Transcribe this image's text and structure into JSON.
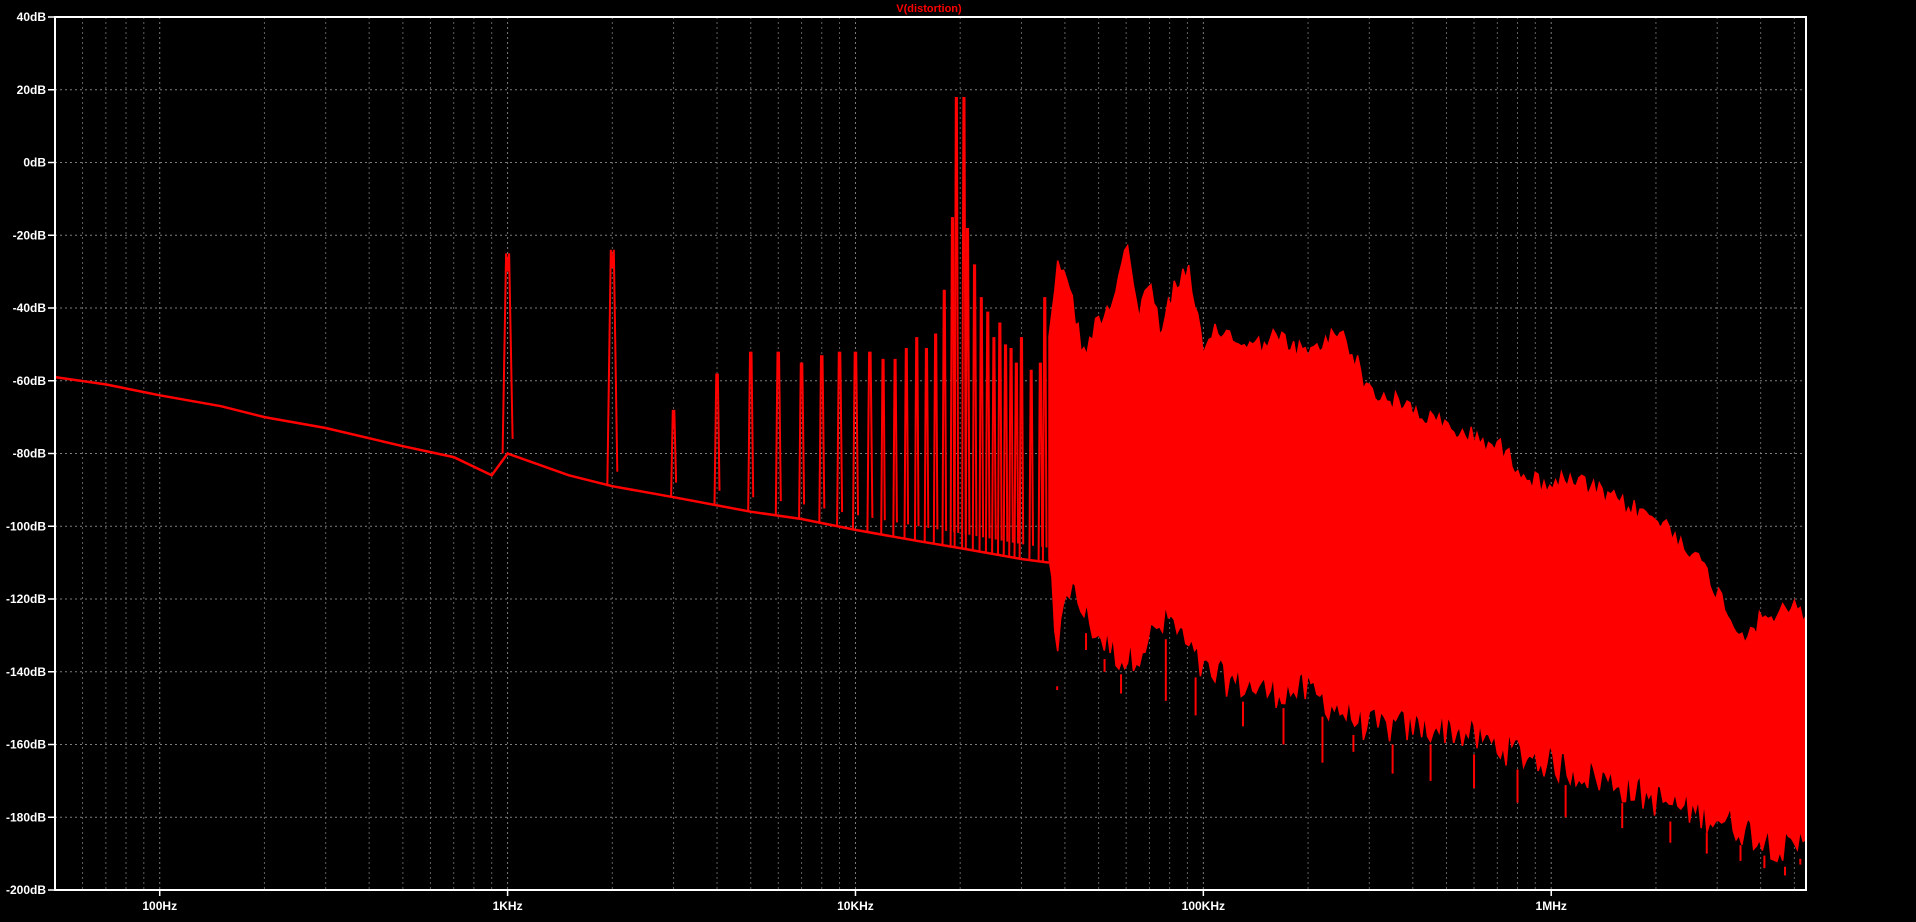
{
  "window": {
    "trace_label": "V(distortion)"
  },
  "colors": {
    "background": "#000000",
    "frame": "#ffffff",
    "grid": "#8a8a8a",
    "text": "#ffffff",
    "trace": "#ff0000"
  },
  "chart_data": {
    "type": "line",
    "title": "V(distortion)",
    "xlabel": "",
    "ylabel": "",
    "x_scale": "log",
    "xlim": [
      50,
      5400000
    ],
    "ylim": [
      -200,
      40
    ],
    "grid": true,
    "x_ticks": [
      {
        "value": 100,
        "label": "100Hz"
      },
      {
        "value": 1000,
        "label": "1KHz"
      },
      {
        "value": 10000,
        "label": "10KHz"
      },
      {
        "value": 100000,
        "label": "100KHz"
      },
      {
        "value": 1000000,
        "label": "1MHz"
      }
    ],
    "y_ticks": [
      {
        "value": 40,
        "label": "40dB"
      },
      {
        "value": 20,
        "label": "20dB"
      },
      {
        "value": 0,
        "label": "0dB"
      },
      {
        "value": -20,
        "label": "-20dB"
      },
      {
        "value": -40,
        "label": "-40dB"
      },
      {
        "value": -60,
        "label": "-60dB"
      },
      {
        "value": -80,
        "label": "-80dB"
      },
      {
        "value": -100,
        "label": "-100dB"
      },
      {
        "value": -120,
        "label": "-120dB"
      },
      {
        "value": -140,
        "label": "-140dB"
      },
      {
        "value": -160,
        "label": "-160dB"
      },
      {
        "value": -180,
        "label": "-180dB"
      },
      {
        "value": -200,
        "label": "-200dB"
      }
    ],
    "series": [
      {
        "name": "V(distortion)",
        "color": "#ff0000",
        "noise_floor": [
          [
            50,
            -59
          ],
          [
            70,
            -61
          ],
          [
            100,
            -64
          ],
          [
            150,
            -67
          ],
          [
            200,
            -70
          ],
          [
            300,
            -73
          ],
          [
            500,
            -78
          ],
          [
            700,
            -81
          ],
          [
            900,
            -86
          ],
          [
            1000,
            -80
          ],
          [
            1500,
            -86
          ],
          [
            2000,
            -89
          ],
          [
            3000,
            -92
          ],
          [
            5000,
            -96
          ],
          [
            7000,
            -98
          ],
          [
            10000,
            -101
          ],
          [
            15000,
            -104
          ],
          [
            20000,
            -106
          ],
          [
            30000,
            -109
          ],
          [
            36000,
            -110
          ]
        ],
        "discrete_peaks": [
          [
            1000,
            -30
          ],
          [
            2000,
            -29
          ],
          [
            3000,
            -73
          ],
          [
            4000,
            -63
          ],
          [
            5000,
            -57
          ],
          [
            6000,
            -57
          ],
          [
            7000,
            -60
          ],
          [
            8000,
            -58
          ],
          [
            9000,
            -57
          ],
          [
            10000,
            -57
          ],
          [
            11000,
            -57
          ],
          [
            12000,
            -59
          ],
          [
            13000,
            -59
          ],
          [
            14000,
            -56
          ],
          [
            15000,
            -53
          ],
          [
            16000,
            -56
          ],
          [
            17000,
            -52
          ],
          [
            18000,
            -40
          ],
          [
            19000,
            -20
          ],
          [
            19500,
            13
          ],
          [
            20500,
            13
          ],
          [
            21000,
            -23
          ],
          [
            22000,
            -33
          ],
          [
            23000,
            -42
          ],
          [
            24000,
            -46
          ],
          [
            25000,
            -53
          ],
          [
            26000,
            -49
          ],
          [
            27000,
            -55
          ],
          [
            28000,
            -56
          ],
          [
            29000,
            -60
          ],
          [
            30000,
            -53
          ],
          [
            32000,
            -62
          ],
          [
            34000,
            -60
          ],
          [
            35000,
            -42
          ]
        ],
        "band_upper": [
          [
            36000,
            -44
          ],
          [
            38000,
            -26
          ],
          [
            40000,
            -25
          ],
          [
            45000,
            -50
          ],
          [
            50000,
            -40
          ],
          [
            55000,
            -35
          ],
          [
            60000,
            -18
          ],
          [
            65000,
            -40
          ],
          [
            70000,
            -28
          ],
          [
            75000,
            -45
          ],
          [
            80000,
            -35
          ],
          [
            90000,
            -25
          ],
          [
            100000,
            -50
          ],
          [
            110000,
            -43
          ],
          [
            120000,
            -45
          ],
          [
            140000,
            -48
          ],
          [
            160000,
            -45
          ],
          [
            200000,
            -50
          ],
          [
            250000,
            -43
          ],
          [
            300000,
            -60
          ],
          [
            400000,
            -65
          ],
          [
            500000,
            -70
          ],
          [
            700000,
            -75
          ],
          [
            900000,
            -85
          ],
          [
            1200000,
            -85
          ],
          [
            1500000,
            -90
          ],
          [
            2000000,
            -95
          ],
          [
            2500000,
            -103
          ],
          [
            3000000,
            -115
          ],
          [
            3500000,
            -127
          ],
          [
            4200000,
            -122
          ],
          [
            5000000,
            -120
          ],
          [
            5400000,
            -121
          ]
        ],
        "band_lower": [
          [
            36000,
            -112
          ],
          [
            38000,
            -145
          ],
          [
            40000,
            -120
          ],
          [
            50000,
            -135
          ],
          [
            60000,
            -142
          ],
          [
            80000,
            -130
          ],
          [
            100000,
            -145
          ],
          [
            150000,
            -150
          ],
          [
            200000,
            -150
          ],
          [
            300000,
            -160
          ],
          [
            500000,
            -160
          ],
          [
            700000,
            -165
          ],
          [
            1000000,
            -170
          ],
          [
            1500000,
            -175
          ],
          [
            2000000,
            -180
          ],
          [
            3000000,
            -185
          ],
          [
            4000000,
            -190
          ],
          [
            5000000,
            -195
          ],
          [
            5400000,
            -188
          ]
        ],
        "band_spikes_down": [
          [
            38000,
            -144
          ],
          [
            46000,
            -134
          ],
          [
            52000,
            -140
          ],
          [
            58000,
            -146
          ],
          [
            66000,
            -138
          ],
          [
            78000,
            -148
          ],
          [
            95000,
            -152
          ],
          [
            130000,
            -155
          ],
          [
            170000,
            -160
          ],
          [
            220000,
            -165
          ],
          [
            270000,
            -162
          ],
          [
            350000,
            -168
          ],
          [
            450000,
            -170
          ],
          [
            600000,
            -172
          ],
          [
            800000,
            -176
          ],
          [
            1100000,
            -180
          ],
          [
            1600000,
            -183
          ],
          [
            2200000,
            -187
          ],
          [
            2800000,
            -190
          ],
          [
            3500000,
            -192
          ],
          [
            4100000,
            -194
          ],
          [
            4700000,
            -196
          ],
          [
            5200000,
            -193
          ]
        ]
      }
    ]
  }
}
